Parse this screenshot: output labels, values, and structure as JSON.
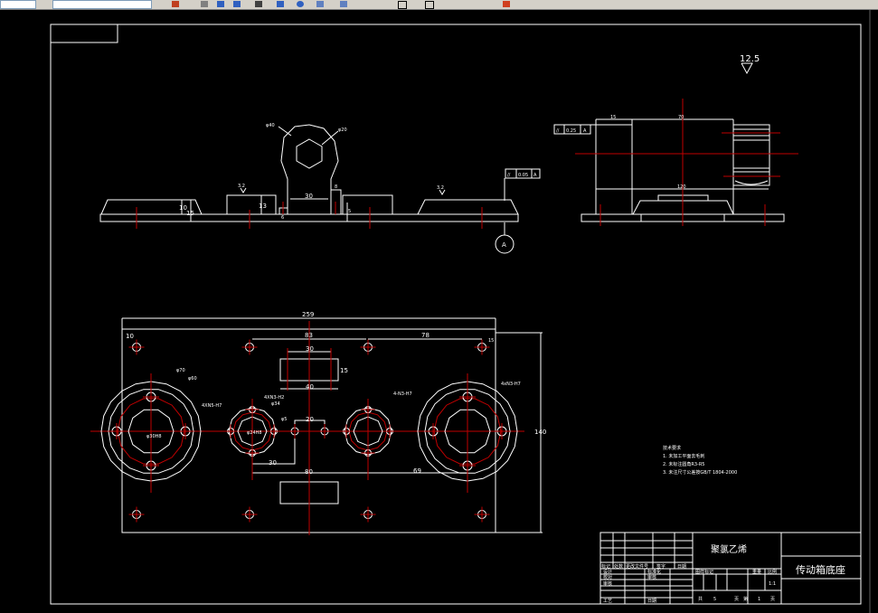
{
  "toolbar": {
    "icons": [
      "layer-icon",
      "properties-icon",
      "match-icon",
      "layers-icon",
      "copy-icon",
      "dropdown-icon",
      "refresh-icon",
      "grid-icon",
      "table-icon",
      "line-icon",
      "rectangle-icon",
      "rect2-icon",
      "line2-icon",
      "line3-icon",
      "paint-icon"
    ],
    "colors": {
      "background": "#d4d0c8"
    }
  },
  "drawing": {
    "colors": {
      "background": "#000000",
      "lines": "#ffffff",
      "centerlines": "#c00000"
    },
    "front_view": {
      "dia40": "φ40",
      "dia20": "φ20",
      "rough1": "3.2",
      "rough2": "3.2",
      "dim30": "30",
      "dim8": "8",
      "dim13": "13",
      "dim10": "10",
      "dim15": "15",
      "dim5": "5",
      "dim6": "6",
      "fcf_sym": "//",
      "fcf_val": "0.05",
      "fcf_datum": "A",
      "datum": "A"
    },
    "side_view": {
      "roughness": "12.5",
      "dim15": "15",
      "dim70": "70",
      "dim120": "120",
      "fcf_sym": "//",
      "fcf_val": "0.25",
      "fcf_datum": "A"
    },
    "top_view": {
      "dim259": "259",
      "dim140": "140",
      "dim83": "83",
      "dim78": "78",
      "dim10": "10",
      "dim15a": "15",
      "dim30a": "30",
      "dim40": "40",
      "dim15b": "15",
      "dia70": "φ70",
      "dia60": "φ60",
      "dia30h8": "φ30H8",
      "holes_left": "4XN5-H7",
      "holes_midleft": "4XN3-H2",
      "dia34": "φ34",
      "dia24h8": "φ24H8",
      "dia5": "φ5",
      "dim20": "20",
      "dim30b": "30",
      "dim80": "80",
      "dim69": "69",
      "holes_midright": "4-N3-H7",
      "holes_right": "4xN3-H7"
    },
    "tech_requirements": {
      "title": "技术要求",
      "items": [
        "1. 未加工平面去毛刺",
        "2. 未标注圆角R3-R5",
        "3. 未注尺寸公差按GB/T 1804-2000"
      ]
    }
  },
  "title_block": {
    "material": "聚氯乙烯",
    "part_name": "传动箱底座",
    "header_row": [
      "标记",
      "处数",
      "更改文件号",
      "签字",
      "日期"
    ],
    "row_design": "设计",
    "row_standard": "标准化",
    "row_check": "校对",
    "row_review": "审核",
    "row_audit": "审核",
    "row_process": "工艺",
    "row_date": "日期",
    "drawing_mark": "图样标记",
    "weight": "重量",
    "scale_label": "比例",
    "scale": "1:1",
    "total_label": "共",
    "total_pages": "5",
    "page_unit": "页",
    "page_label": "第",
    "page_no": "1",
    "page_unit2": "页"
  }
}
